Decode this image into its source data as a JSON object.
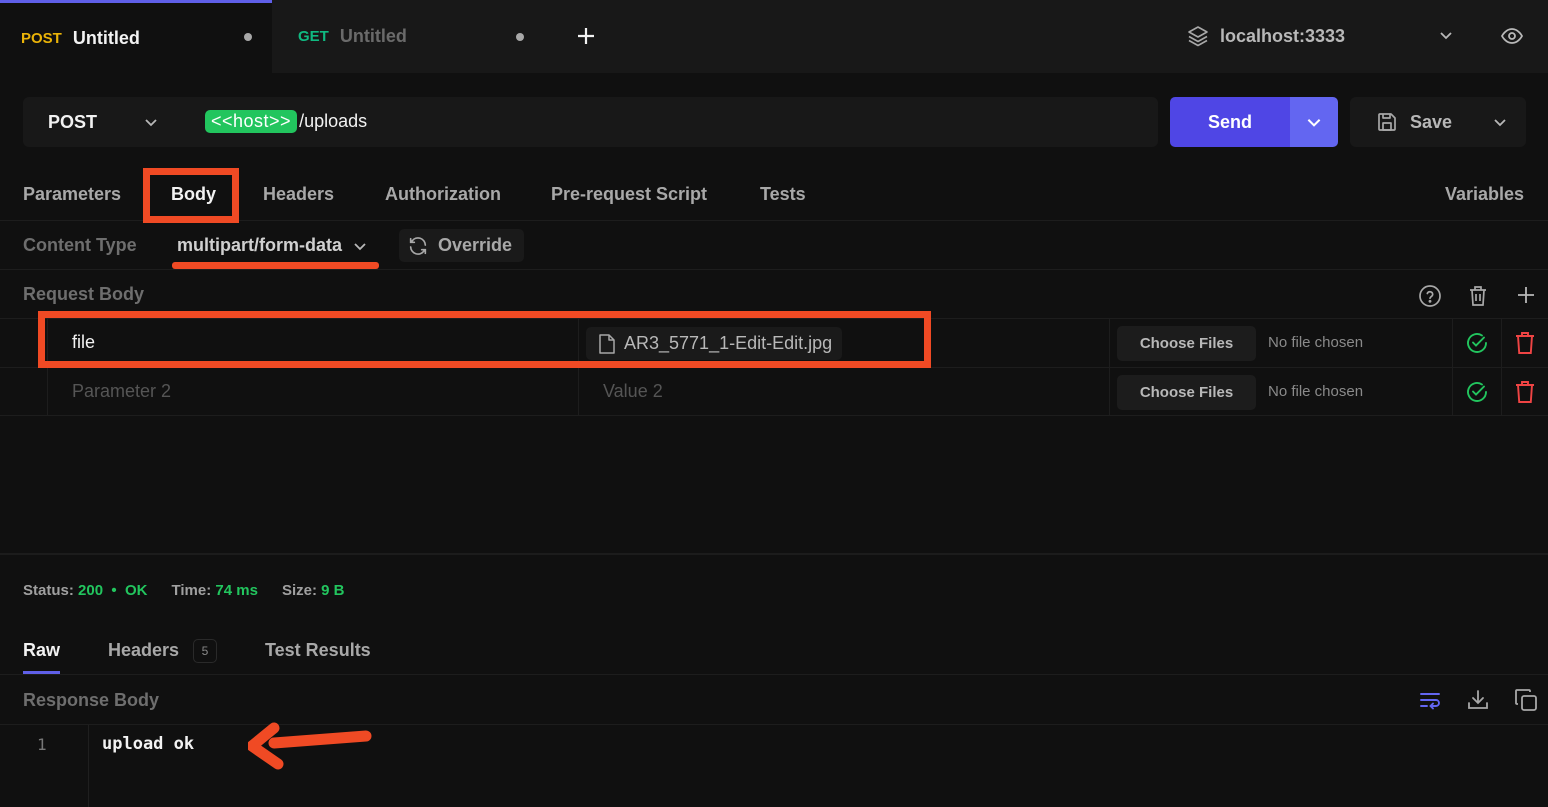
{
  "tabs": [
    {
      "method": "POST",
      "method_color": "#eab308",
      "title": "Untitled",
      "active": true
    },
    {
      "method": "GET",
      "method_color": "#10b981",
      "title": "Untitled",
      "active": false
    }
  ],
  "environment": {
    "name": "localhost:3333"
  },
  "request": {
    "method": "POST",
    "url_variable": "<<host>>",
    "url_path": "/uploads",
    "send_label": "Send",
    "save_label": "Save"
  },
  "request_tabs": {
    "items": [
      "Parameters",
      "Body",
      "Headers",
      "Authorization",
      "Pre-request Script",
      "Tests"
    ],
    "active": "Body",
    "variables_label": "Variables"
  },
  "content_type": {
    "label": "Content Type",
    "value": "multipart/form-data",
    "override_label": "Override"
  },
  "request_body": {
    "title": "Request Body",
    "rows": [
      {
        "key": "file",
        "value": "AR3_5771_1-Edit-Edit.jpg",
        "value_is_file": true,
        "choose_label": "Choose Files",
        "file_status": "No file chosen",
        "enabled": true
      },
      {
        "key_placeholder": "Parameter 2",
        "value_placeholder": "Value 2",
        "choose_label": "Choose Files",
        "file_status": "No file chosen",
        "enabled": true
      }
    ]
  },
  "response": {
    "status_label": "Status:",
    "status_code": "200",
    "status_text": "OK",
    "time_label": "Time:",
    "time_value": "74 ms",
    "size_label": "Size:",
    "size_value": "9 B",
    "tabs": [
      "Raw",
      "Headers",
      "Test Results"
    ],
    "headers_count": "5",
    "active_tab": "Raw",
    "body_title": "Response Body",
    "lines": [
      {
        "number": "1",
        "text": "upload ok"
      }
    ]
  },
  "colors": {
    "accent": "#5f5fe8",
    "send": "#4f46e5",
    "success": "#22c55e",
    "danger": "#ef4444",
    "annotation": "#f04a24"
  }
}
